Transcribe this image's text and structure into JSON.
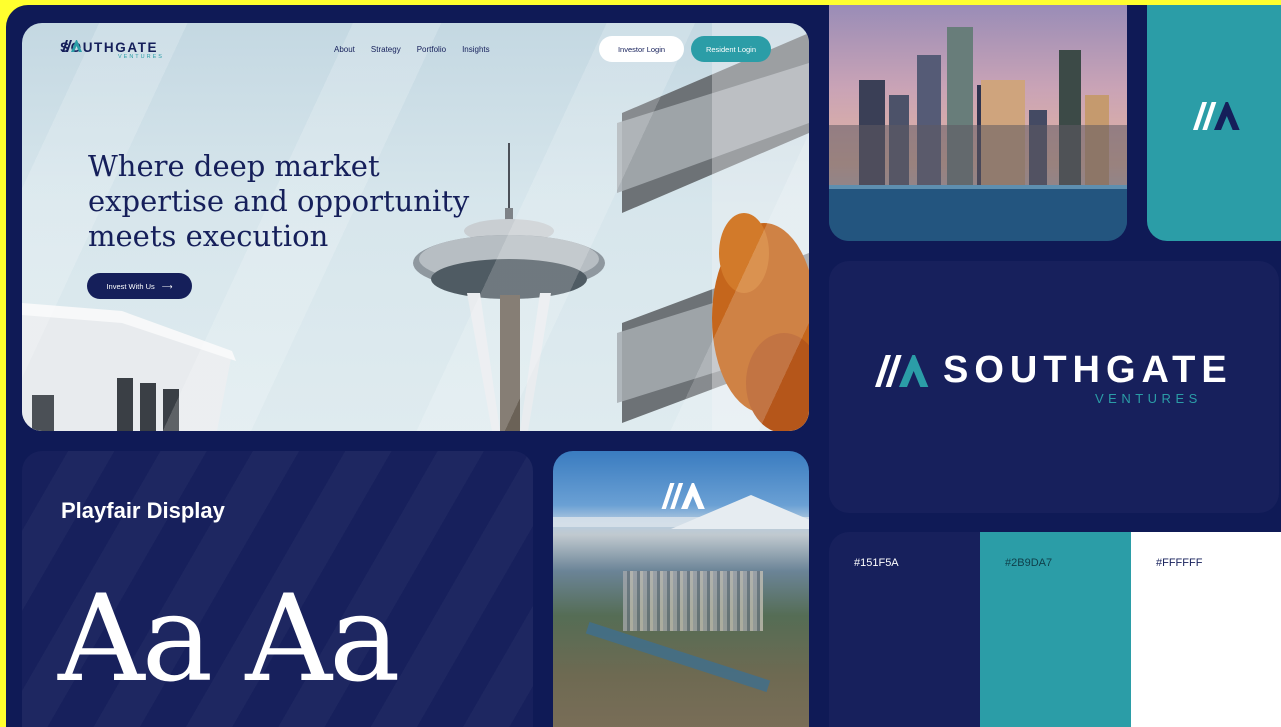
{
  "brand": {
    "name": "SOUTHGATE",
    "tagline": "VENTURES"
  },
  "nav": {
    "links": [
      "About",
      "Strategy",
      "Portfolio",
      "Insights"
    ],
    "investor_login": "Investor Login",
    "resident_login": "Resident Login"
  },
  "hero": {
    "headline": "Where deep market expertise and opportunity meets execution",
    "cta_label": "Invest With Us",
    "cta_arrow": "⟶"
  },
  "typography": {
    "font_name": "Playfair Display",
    "sample": "Aa Aa"
  },
  "palette": [
    {
      "label": "#151F5A",
      "color": "#151f5a"
    },
    {
      "label": "#2B9DA7",
      "color": "#2b9da7"
    },
    {
      "label": "#FFFFFF",
      "color": "#ffffff"
    }
  ],
  "colors": {
    "navy": "#151f5a",
    "teal": "#2b9da7",
    "white": "#ffffff",
    "background": "#ffff2e"
  },
  "icons": [
    "southgate-logo-mark-icon",
    "arrow-right-icon"
  ]
}
